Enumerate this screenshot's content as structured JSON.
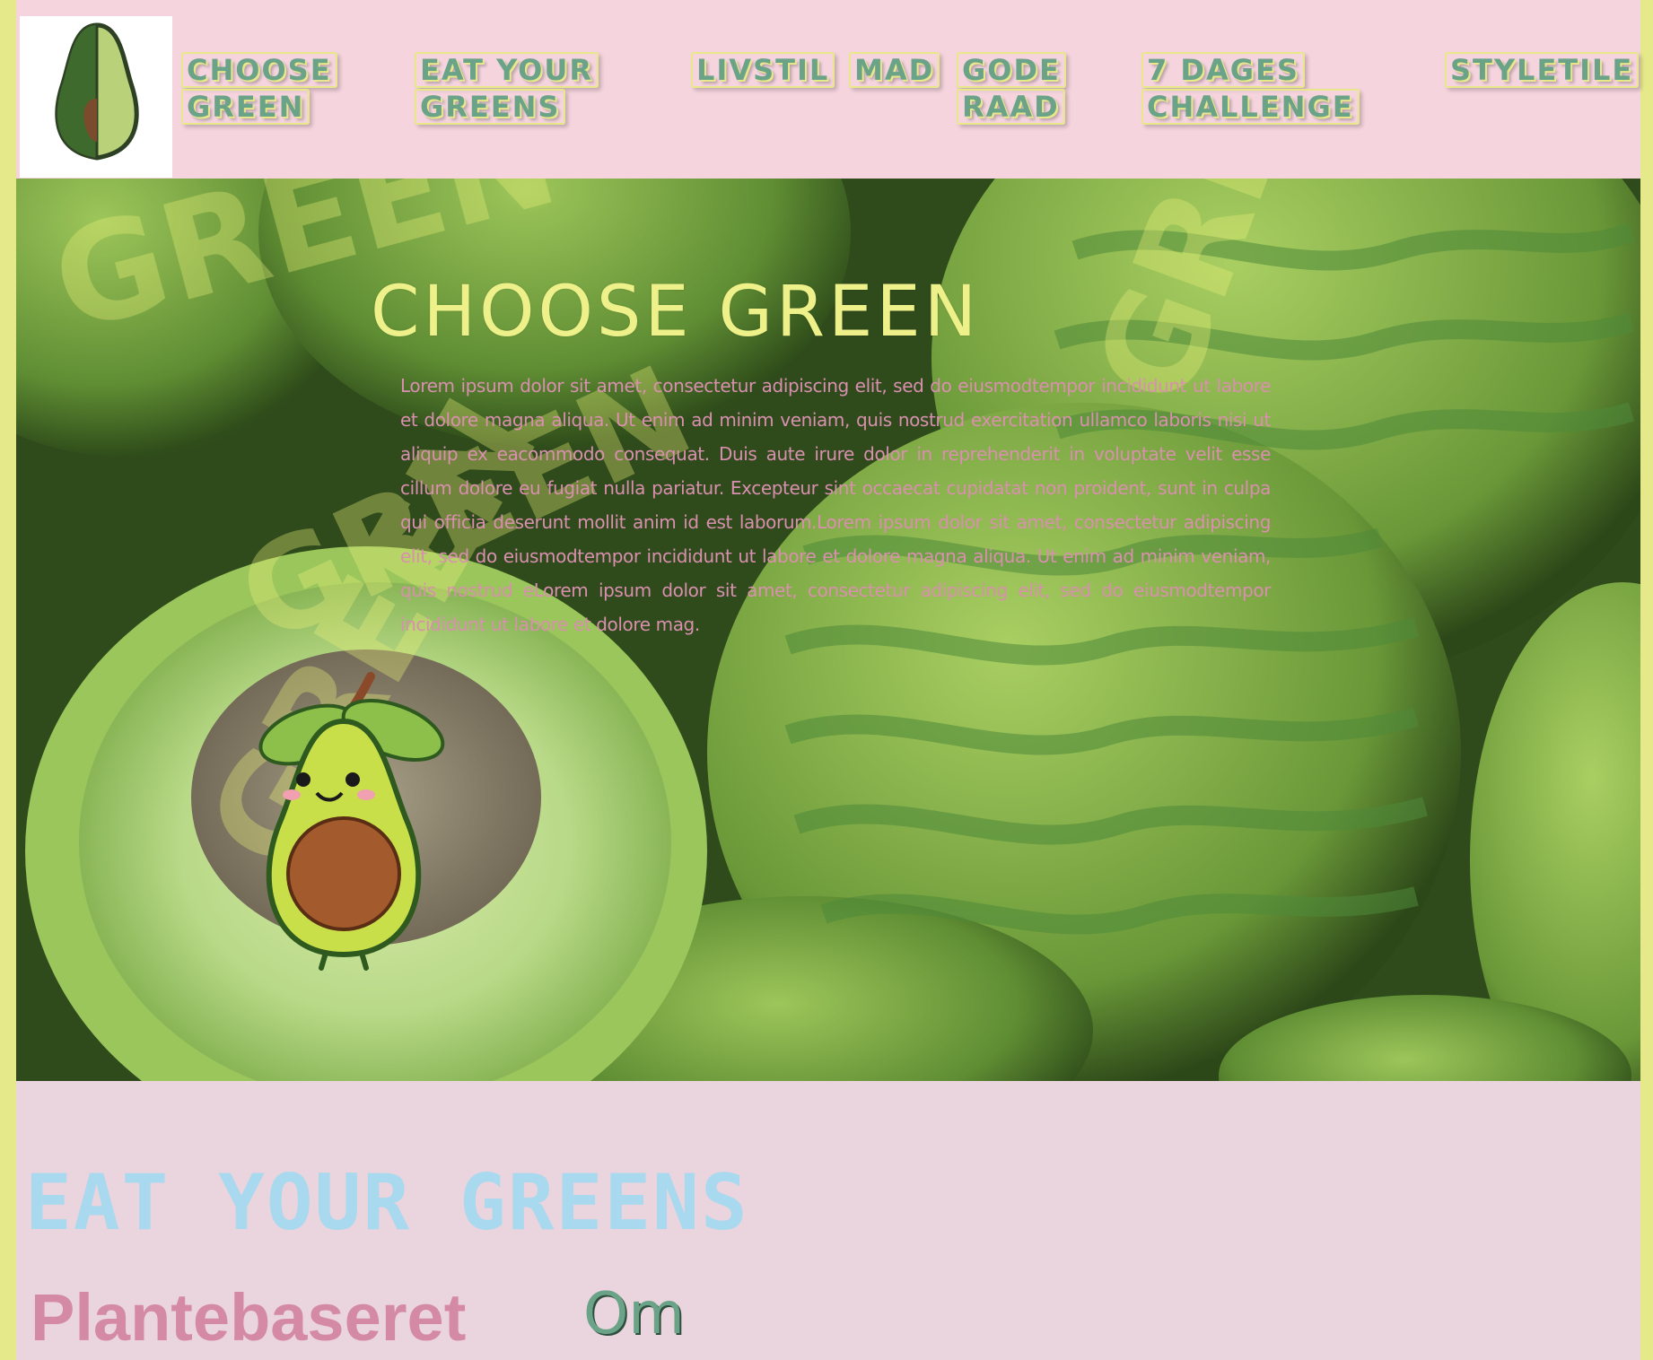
{
  "nav": {
    "items": [
      {
        "lines": [
          "CHOOSE",
          "GREEN"
        ]
      },
      {
        "lines": [
          "EAT YOUR",
          "GREENS"
        ]
      },
      {
        "lines": [
          "LIVSTIL"
        ]
      },
      {
        "lines": [
          "MAD"
        ]
      },
      {
        "lines": [
          "GODE",
          "RAAD"
        ]
      },
      {
        "lines": [
          "7 DAGES",
          "CHALLENGE"
        ]
      },
      {
        "lines": [
          "STYLeTILE"
        ]
      }
    ]
  },
  "hero": {
    "title": "CHOOSE GREEN",
    "body": "Lorem ipsum dolor sit amet, consectetur adipiscing elit, sed do eiusmodtempor incididunt ut labore et dolore magna aliqua. Ut enim ad minim veniam, quis nostrud exercitation ullamco laboris nisi ut aliquip ex eacommodo consequat. Duis aute irure dolor in reprehenderit in voluptate velit esse cillum dolore eu fugiat nulla pariatur. Excepteur sint occaecat cupidatat non proident, sunt in culpa qui officia deserunt mollit anim id est laborum.Lorem ipsum dolor sit amet, consectetur adipiscing elit, sed do eiusmodtempor incididunt ut labore et dolore magna aliqua. Ut enim ad minim veniam, quis nostrud eLorem ipsum dolor sit amet, consectetur adipiscing elit, sed do eiusmodtempor incididunt ut labore et dolore mag."
  },
  "section": {
    "heading": "EAT YOUR GREENS",
    "subheading": "Plantebaseret",
    "om_label": "Om"
  },
  "colors": {
    "header_bg": "#f6d4de",
    "page_bg": "#ead4dd",
    "nav_text": "#6aa388",
    "accent_yellow": "#eef08a",
    "body_pink": "#d98fae",
    "heading_blue": "#a8d9ee",
    "subheading_pink": "#d48aa5"
  }
}
